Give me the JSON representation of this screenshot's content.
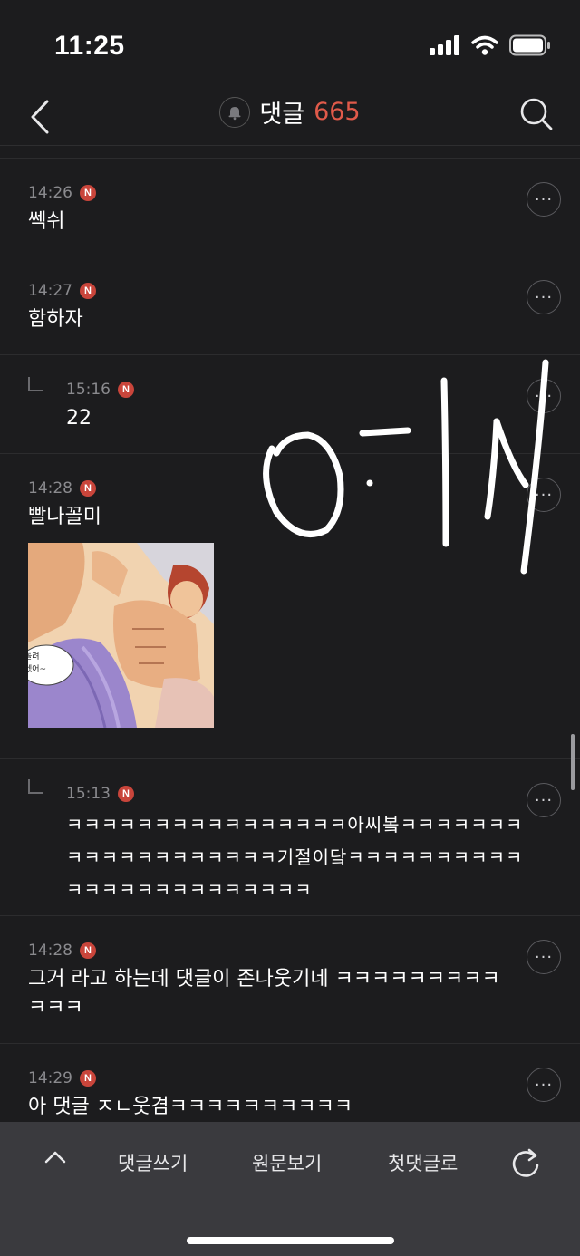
{
  "status_bar": {
    "time": "11:25"
  },
  "header": {
    "title": "댓글",
    "count": "665"
  },
  "comments": [
    {
      "time": "14:26",
      "badge": "N",
      "text": "쎅쉬"
    },
    {
      "time": "14:27",
      "badge": "N",
      "text": "함하자"
    },
    {
      "time": "15:16",
      "badge": "N",
      "text": "22",
      "reply": true
    },
    {
      "time": "14:28",
      "badge": "N",
      "text": "빨나꼴미",
      "has_image": true,
      "image_speech_text": "돌려\n겠어~"
    },
    {
      "time": "15:13",
      "badge": "N",
      "reply": true,
      "text": "ㅋㅋㅋㅋㅋㅋㅋㅋㅋㅋㅋㅋㅋㅋㅋㅋ아씨봌ㅋㅋㅋㅋㅋㅋㅋㅋㅋㅋㅋㅋㅋㅋㅋㅋㅋㅋㅋ기절이닼ㅋㅋㅋㅋㅋㅋㅋㅋㅋㅋㅋㅋㅋㅋㅋㅋㅋㅋㅋㅋㅋㅋㅋㅋ"
    },
    {
      "time": "14:28",
      "badge": "N",
      "text": "그거 라고 하는데 댓글이 존나웃기네 ㅋㅋㅋㅋㅋㅋㅋㅋㅋㅋㅋㅋ"
    },
    {
      "time": "14:29",
      "badge": "N",
      "text": "아 댓글 ㅈㄴ웃겸ㅋㅋㅋㅋㅋㅋㅋㅋㅋㅋ"
    }
  ],
  "more_button_label": "···",
  "handwriting_text": "아씨",
  "bottom_bar": {
    "up_icon": "chevron-up-icon",
    "write": "댓글쓰기",
    "original": "원문보기",
    "first": "첫댓글로",
    "refresh_icon": "refresh-icon"
  },
  "colors": {
    "background": "#1c1c1e",
    "accent": "#e05a4a",
    "badge": "#c9453b",
    "bottom_bar": "#3a3a3e"
  }
}
